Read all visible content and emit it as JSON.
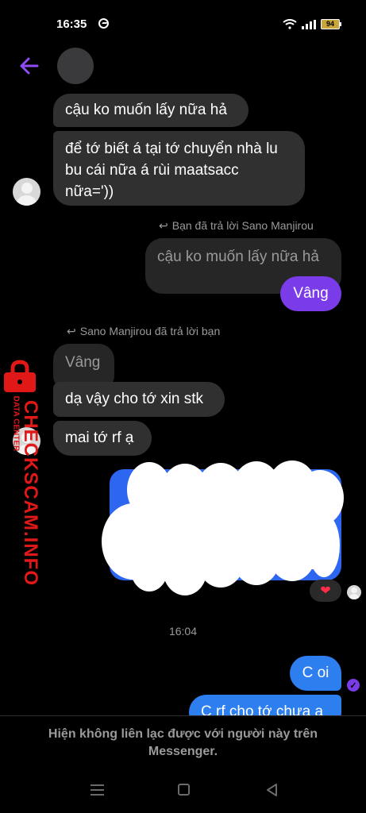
{
  "status_bar": {
    "time": "16:35",
    "battery": "94",
    "messenger_icon": "messenger-icon",
    "wifi_icon": "wifi-icon",
    "signal_icon": "signal-icon"
  },
  "header": {
    "back_icon": "arrow-left-icon",
    "accent_color": "#8f4cf5"
  },
  "messages": {
    "m1": "cậu ko muốn lấy nữa hả",
    "m2_line1": "để tớ biết á tại tớ chuyển nhà lu",
    "m2_line2": "bu cái nữa á rùi maatsacc",
    "m2_line3": "nữa='))",
    "reply1_label": "Bạn đã trả lời Sano Manjirou",
    "reply1_quote": "cậu ko muốn lấy nữa hả",
    "reply1_text": "Vâng",
    "reply2_label": "Sano Manjirou đã trả lời bạn",
    "reply2_quote": "Vâng",
    "m3": "dạ vậy cho tớ xin stk",
    "m4": "mai tớ rf ạ",
    "reaction": "❤",
    "timestamp": "16:04",
    "m5": "C oi",
    "m6": "C rf cho tớ chưa a"
  },
  "watermark": {
    "brand": "CHECKSCAM.INFO",
    "sub": "DATA CENTER"
  },
  "footer": {
    "notice_line1": "Hiện không liên lạc được với người này trên",
    "notice_line2": "Messenger."
  },
  "colors": {
    "background": "#000000",
    "incoming_bubble": "#303030",
    "outgoing_purple": "#7a3ce8",
    "outgoing_blue": "#2d7ff0",
    "watermark_red": "#e01818"
  }
}
